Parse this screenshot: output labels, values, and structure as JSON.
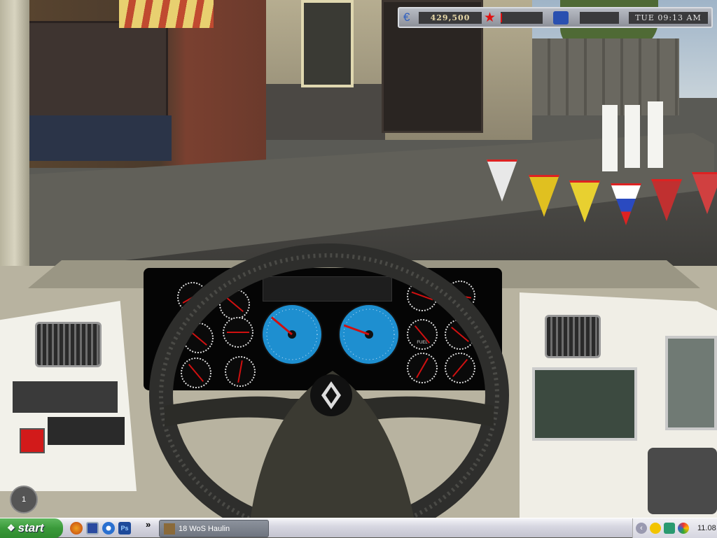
{
  "game": {
    "hud": {
      "money": "429,500",
      "currency_icon": "euro-icon",
      "rating_icon": "star-icon",
      "damage_fraction": 0.03,
      "truck_icon": "truck-icon",
      "cargo_status": "",
      "clock": "TUE 09:13 AM"
    },
    "dashboard": {
      "fuel_label": "FUEL",
      "gear_indicator": "1",
      "logo_icon": "renault-logo-icon"
    },
    "colors": {
      "hud_text": "#e8d9a8",
      "gauge_blue": "#1e8fd0",
      "needle": "#d01010"
    }
  },
  "taskbar": {
    "start_label": "start",
    "quick_launch": [
      "firefox-icon",
      "show-desktop-icon",
      "media-player-icon",
      "photoshop-icon"
    ],
    "photoshop_label": "Ps",
    "overflow": "»",
    "task_label": "18 WoS Haulin",
    "tray_icons": [
      "yahoo-messenger-icon",
      "network-icon",
      "google-desktop-icon"
    ],
    "clock": "11.08"
  }
}
